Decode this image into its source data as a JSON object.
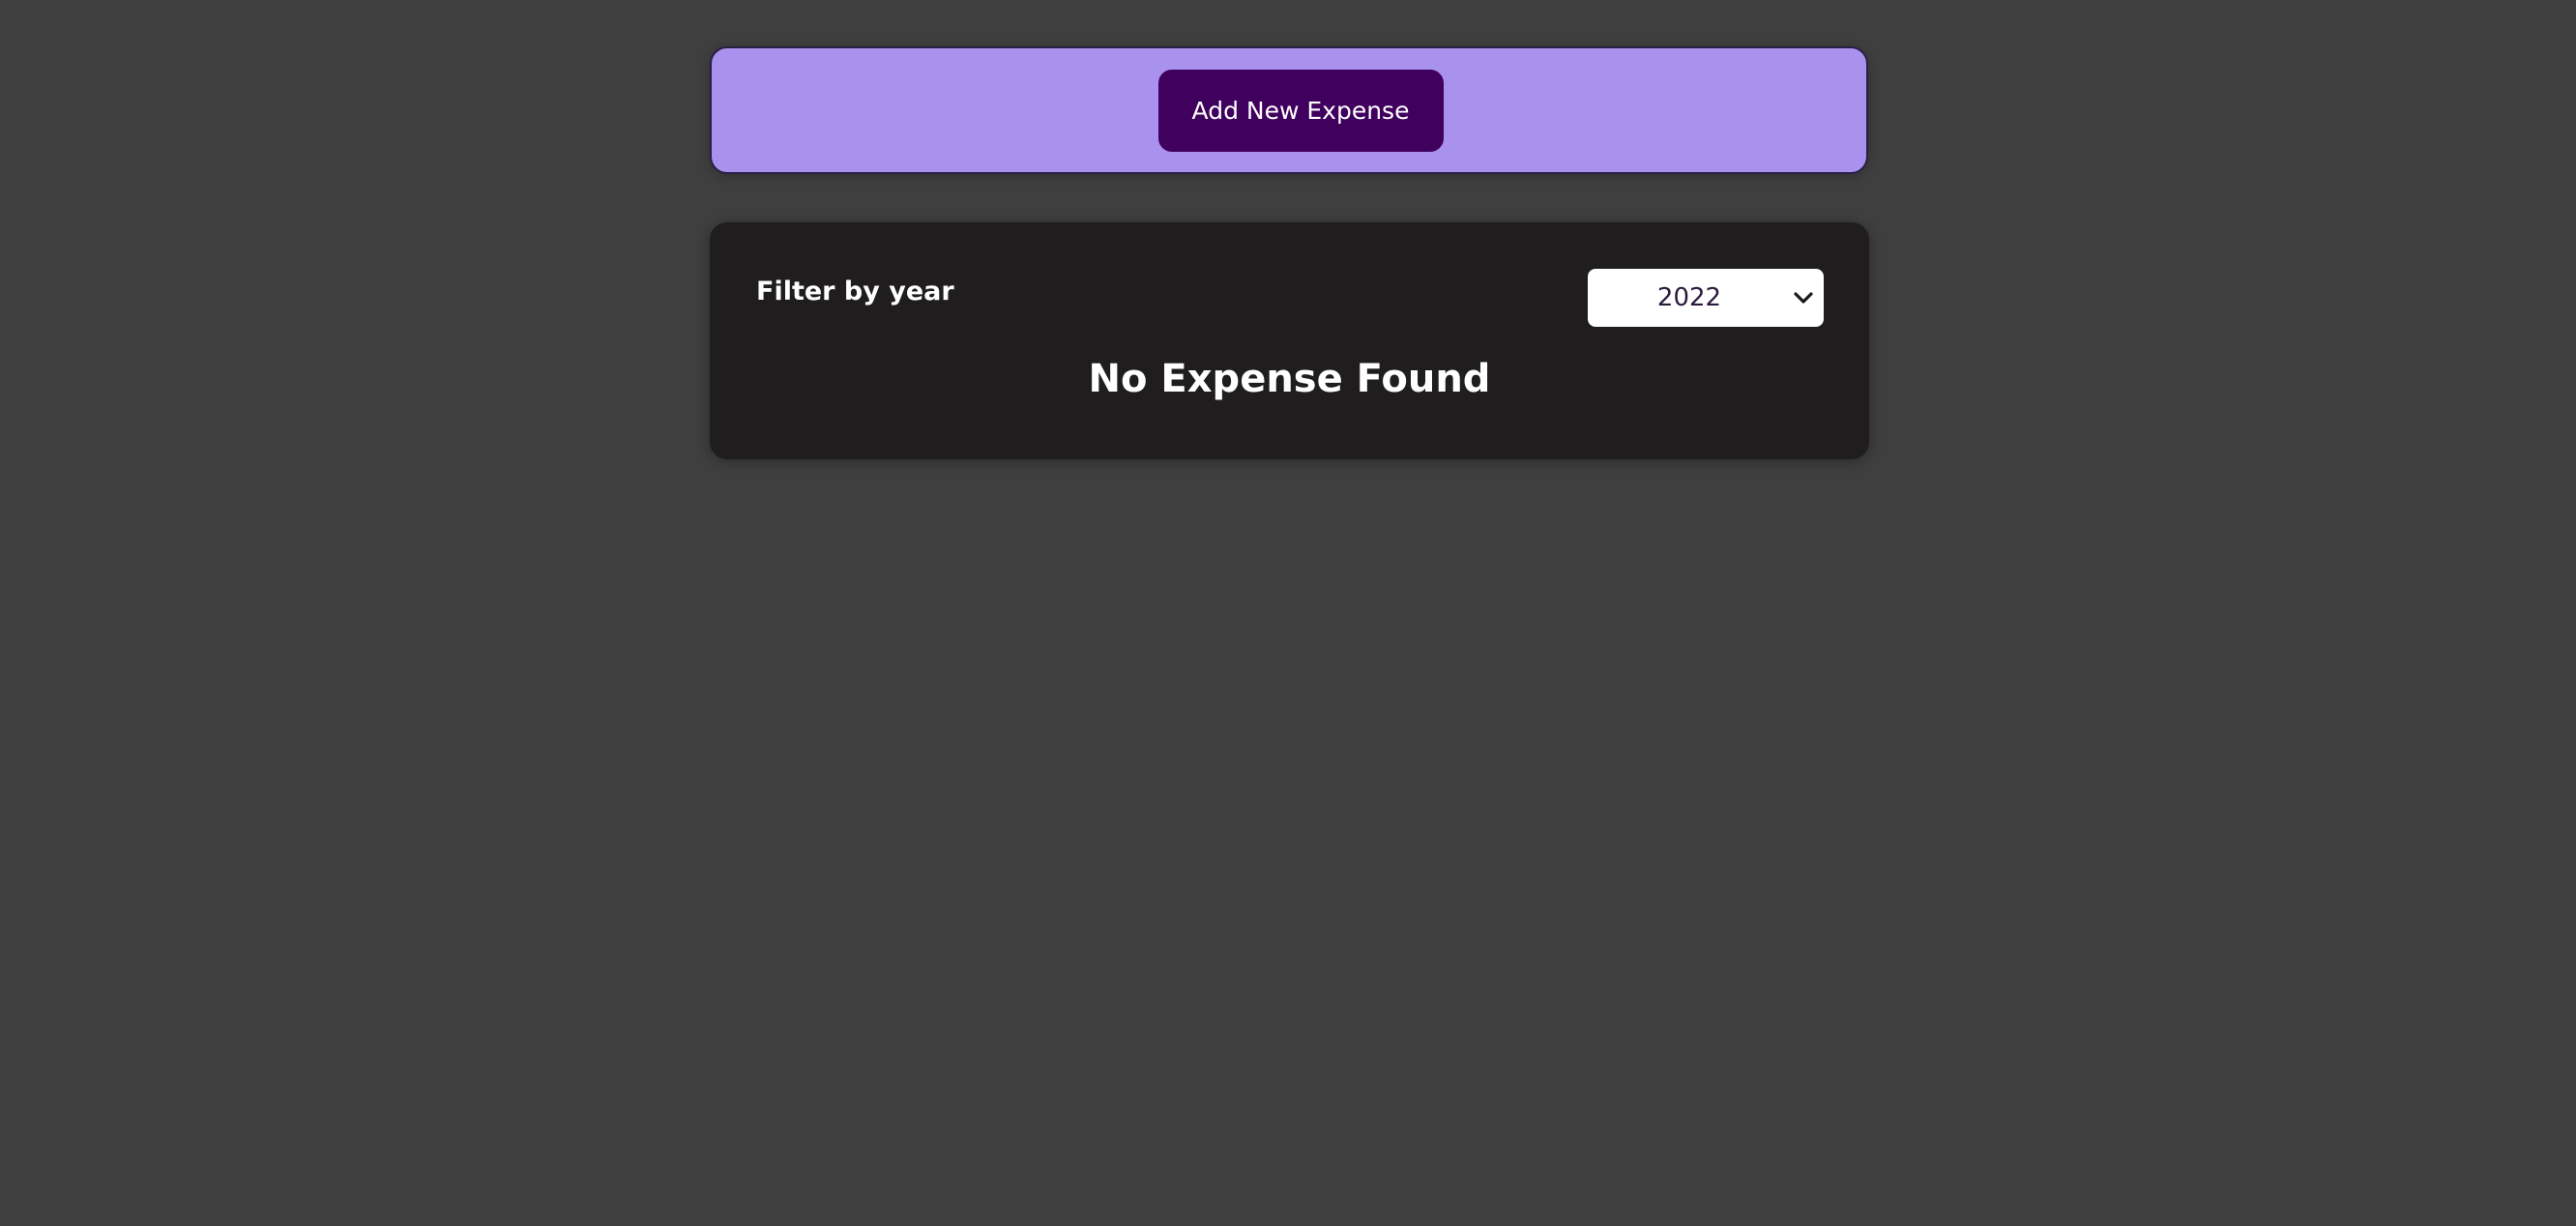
{
  "new_expense": {
    "add_button_label": "Add New Expense"
  },
  "filter": {
    "label": "Filter by year",
    "selected_year": "2022",
    "dropdown_icon": "chevron-down-icon"
  },
  "expenses_list": {
    "empty_message": "No Expense Found"
  },
  "colors": {
    "page_background": "#3f3f3f",
    "form_background": "#a892ee",
    "button_background": "#40005d",
    "panel_background": "#1f1d1e"
  }
}
